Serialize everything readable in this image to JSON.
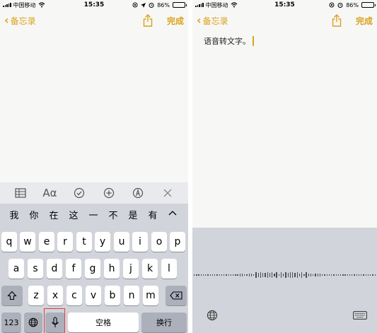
{
  "left": {
    "status": {
      "carrier": "中国移动",
      "time": "15:35",
      "battery": "86%",
      "battery_level": 0.86
    },
    "nav": {
      "back_label": "备忘录",
      "done_label": "完成"
    },
    "toolbar_icons": [
      "table-icon",
      "format-text-icon",
      "checklist-icon",
      "add-icon",
      "markup-icon",
      "close-icon"
    ],
    "toolbar": {
      "format_label": "Aα"
    },
    "candidates": [
      "我",
      "你",
      "在",
      "这",
      "一",
      "不",
      "是",
      "有"
    ],
    "keyboard": {
      "row1": [
        "q",
        "w",
        "e",
        "r",
        "t",
        "y",
        "u",
        "i",
        "o",
        "p"
      ],
      "row2": [
        "a",
        "s",
        "d",
        "f",
        "g",
        "h",
        "j",
        "k",
        "l"
      ],
      "row3": [
        "z",
        "x",
        "c",
        "v",
        "b",
        "n",
        "m"
      ],
      "numbers_label": "123",
      "space_label": "空格",
      "return_label": "换行"
    }
  },
  "right": {
    "status": {
      "carrier": "中国移动",
      "time": "15:35",
      "battery": "86%",
      "battery_level": 0.86
    },
    "nav": {
      "back_label": "备忘录",
      "done_label": "完成"
    },
    "note": {
      "text": "语音转文字。"
    }
  },
  "colors": {
    "accent": "#d9a31e",
    "keyboard_bg": "#d1d4da",
    "highlight": "#e04040"
  }
}
